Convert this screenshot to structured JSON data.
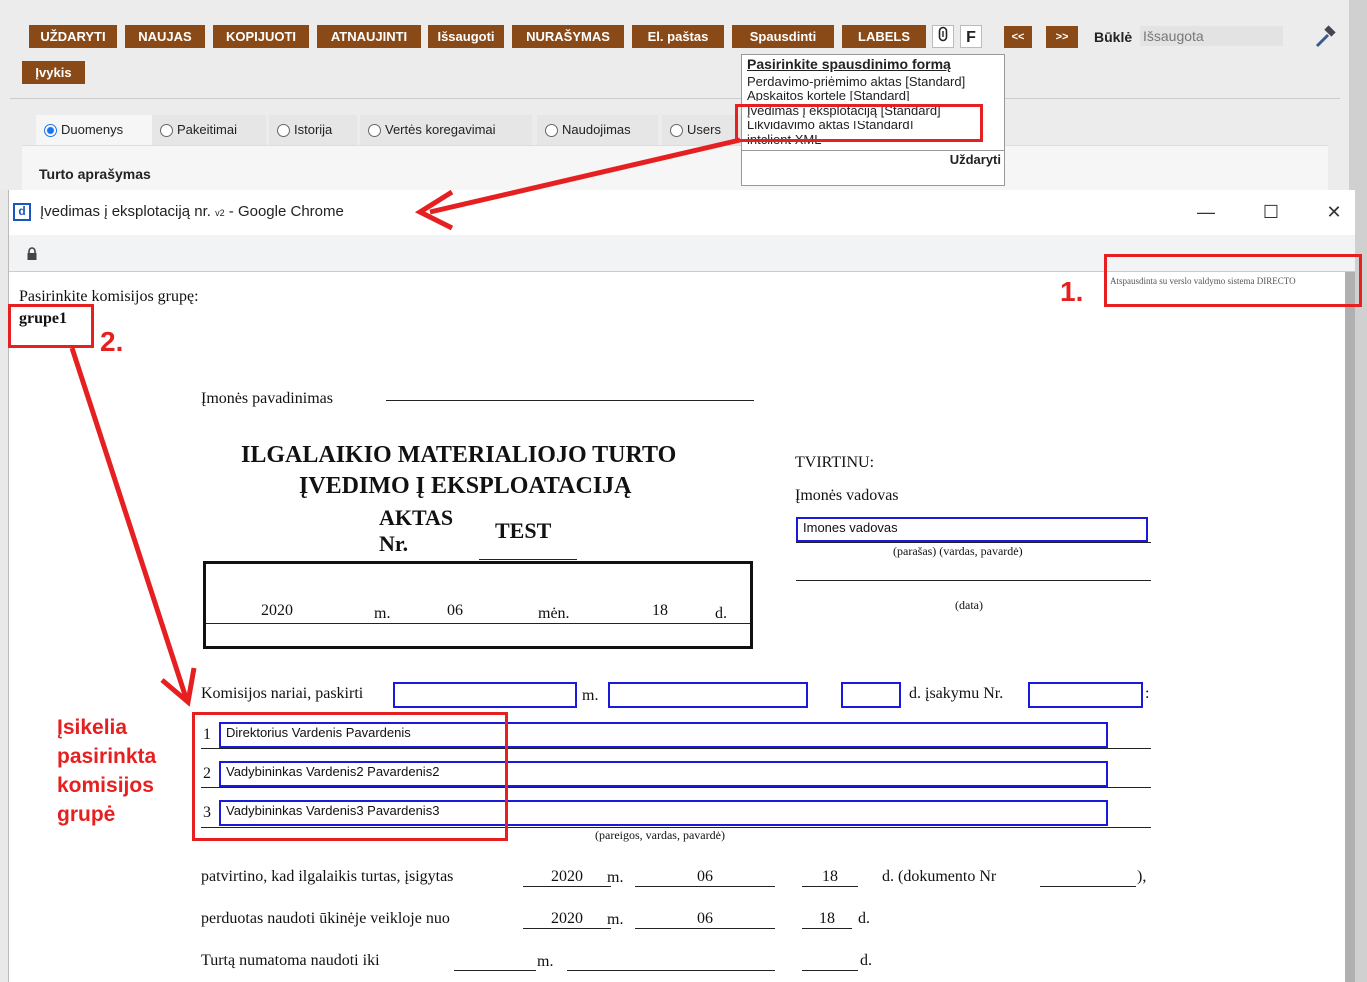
{
  "toolbar": {
    "buttons": [
      "UŽDARYTI",
      "NAUJAS",
      "KOPIJUOTI",
      "ATNAUJINTI",
      "Išsaugoti",
      "NURAŠYMAS",
      "El. paštas",
      "Spausdinti",
      "LABELS"
    ],
    "attach_symbol": "0",
    "f_label": "F",
    "prev": "<<",
    "next": ">>",
    "status_label": "Būklė",
    "status_value": "Išsaugota",
    "event_button": "Įvykis"
  },
  "tabs": [
    "Duomenys",
    "Pakeitimai",
    "Istorija",
    "Vertės koregavimai",
    "Naudojimas",
    "Users"
  ],
  "panel_title": "Turto aprašymas",
  "print_menu": {
    "title": "Pasirinkite spausdinimo formą",
    "items": [
      "Perdavimo-priėmimo aktas [Standard]",
      "Apskaitos kortele [Standard]",
      "Įvedimas į eksplotaciją [Standard]",
      "Likvidavimo aktas [Standard]",
      "intclient XML"
    ],
    "close": "Uždaryti"
  },
  "window": {
    "title": "Įvedimas į eksplotaciją nr.",
    "title_sub": "v2",
    "title_suffix": "- Google Chrome",
    "minimize": "—",
    "maximize": "☐",
    "close": "✕"
  },
  "document": {
    "printed_with": "Atspausdinta su verslo valdymo sistema DIRECTO",
    "group_prompt": "Pasirinkite komisijos grupę:",
    "group_value": "grupe1",
    "company_label": "Įmonės pavadinimas",
    "heading_line1": "ILGALAIKIO MATERIALIOJO TURTO",
    "heading_line2": "ĮVEDIMO Į EKSPLOATACIJĄ",
    "heading_line3": "AKTAS",
    "heading_nr": "Nr.",
    "act_number": "TEST",
    "approve": "TVIRTINU:",
    "manager_label": "Įmonės vadovas",
    "manager_value": "Imones vadovas",
    "manager_hint": "(parašas) (vardas, pavardė)",
    "date_hint": "(data)",
    "date_year": "2020",
    "date_m": "m.",
    "date_month": "06",
    "date_men": "mėn.",
    "date_day": "18",
    "date_d": "d.",
    "commission_text": "Komisijos nariai, paskirti",
    "commission_m": "m.",
    "commission_d": "d. įsakymu Nr.",
    "commission_colon": ":",
    "members": [
      {
        "n": "1",
        "value": "Direktorius Vardenis Pavardenis"
      },
      {
        "n": "2",
        "value": "Vadybininkas Vardenis2 Pavardenis2"
      },
      {
        "n": "3",
        "value": "Vadybininkas Vardenis3 Pavardenis3"
      }
    ],
    "members_hint": "(pareigos, vardas, pavardė)",
    "confirm_text": "patvirtino, kad ilgalaikis turtas, įsigytas",
    "confirm_year": "2020",
    "confirm_m": "m.",
    "confirm_month": "06",
    "confirm_day": "18",
    "confirm_doc": "d. (dokumento Nr",
    "confirm_end": "),",
    "transfer_text": "perduotas naudoti ūkinėje veikloje nuo",
    "transfer_year": "2020",
    "transfer_m": "m.",
    "transfer_month": "06",
    "transfer_day": "18",
    "transfer_d": "d.",
    "until_text": "Turtą numatoma naudoti iki",
    "until_m": "m.",
    "until_d": "d."
  },
  "annotations": {
    "label1": "1.",
    "label2": "2.",
    "note_line1": "Įsikelia",
    "note_line2": "pasirinkta",
    "note_line3": "komisijos",
    "note_line4": "grupė"
  },
  "colors": {
    "toolbar_button": "#8a4a17",
    "annotation": "#e62020",
    "field_border": "#1a1adb"
  }
}
